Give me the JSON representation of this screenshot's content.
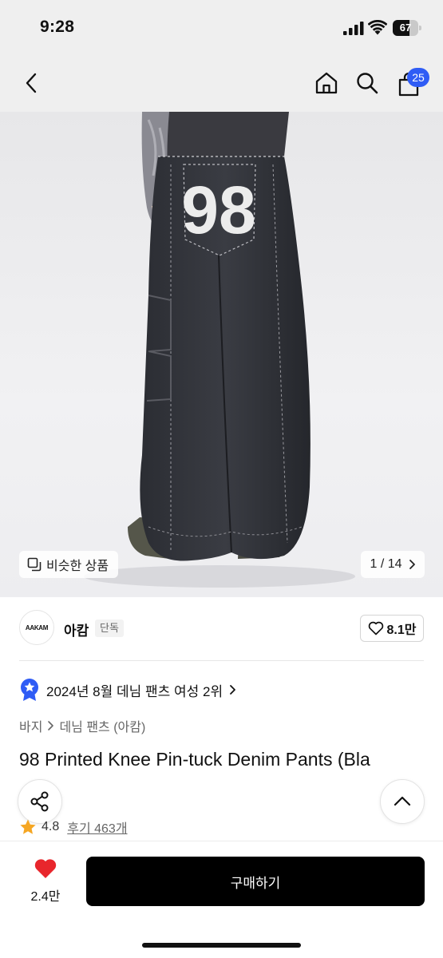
{
  "status_bar": {
    "time": "9:28",
    "battery": "67",
    "battery_level": 0.67
  },
  "nav": {
    "back_icon": "chevron-left-icon",
    "home_icon": "home-icon",
    "search_icon": "search-icon",
    "cart_icon": "shopping-bag-icon",
    "cart_count": "25"
  },
  "hero": {
    "print_text": "98",
    "similar_label": "비슷한 상품",
    "page_current": "1",
    "page_total": "14",
    "page_display": "1 / 14"
  },
  "brand": {
    "logo_text": "AAKAM",
    "name": "아캄",
    "tag": "단독",
    "likes": "8.1만"
  },
  "ranking": {
    "text": "2024년 8월 데님 팬츠 여성 2위"
  },
  "breadcrumb": {
    "level1": "바지",
    "level2": "데님 팬츠 (아캄)"
  },
  "product": {
    "title": "98 Printed Knee Pin-tuck Denim Pants (Bla",
    "rating": "4.8",
    "reviews_label": "후기 463개"
  },
  "bottom": {
    "wish_count": "2.4만",
    "buy_label": "구매하기"
  },
  "colors": {
    "accent": "#2f5cf5",
    "heart": "#e8262c",
    "star": "#f5a623",
    "buy_bg": "#000000"
  }
}
